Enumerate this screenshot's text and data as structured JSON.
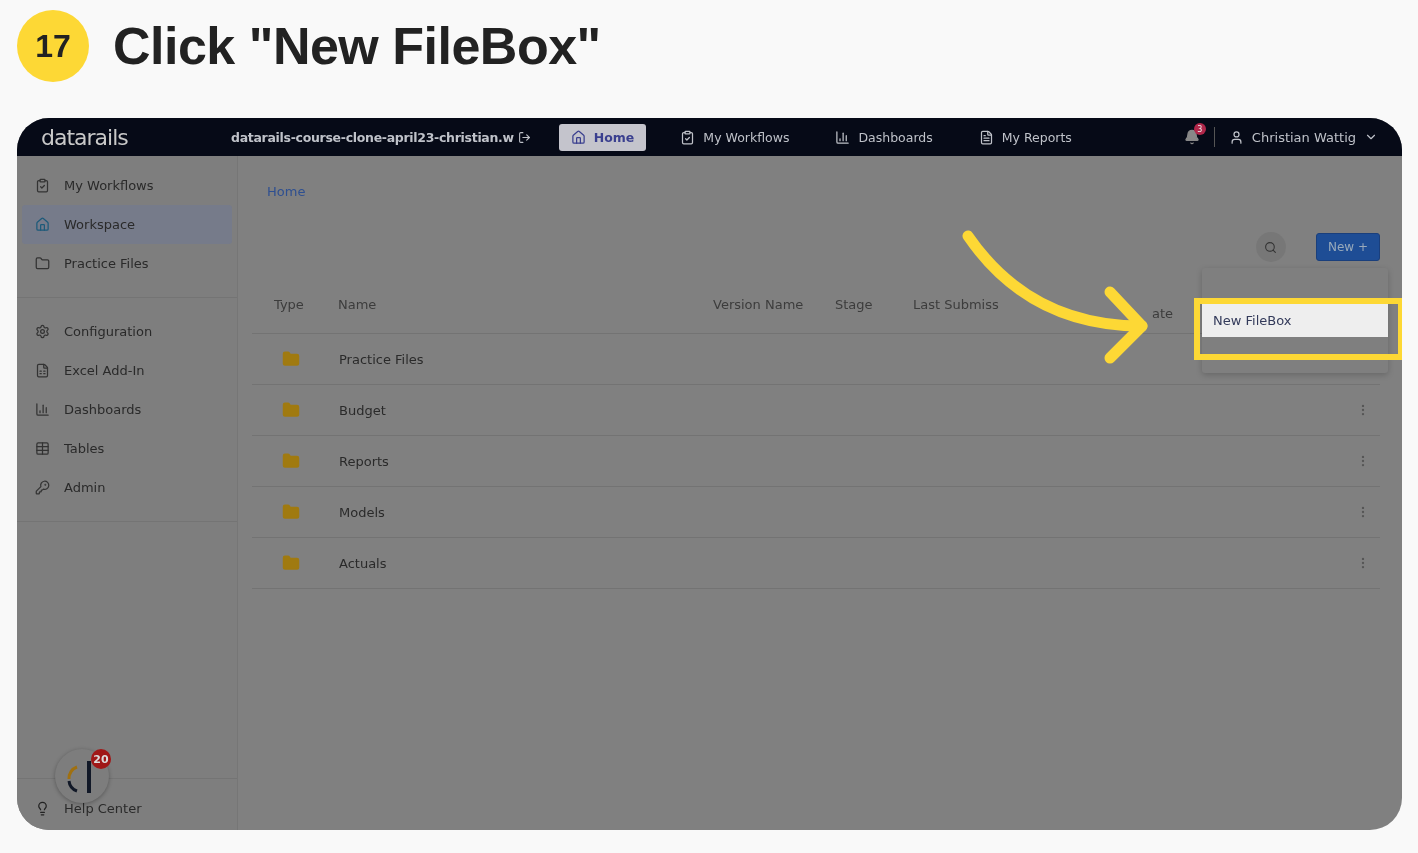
{
  "step": {
    "number": "17",
    "title": "Click \"New FileBox\""
  },
  "topbar": {
    "logo": "datarails",
    "workspace": "datarails-course-clone-april23-christian.w",
    "nav": [
      {
        "label": "Home",
        "selected": true
      },
      {
        "label": "My Workflows",
        "selected": false
      },
      {
        "label": "Dashboards",
        "selected": false
      },
      {
        "label": "My Reports",
        "selected": false
      }
    ],
    "notifications": "3",
    "user": "Christian Wattig"
  },
  "sidebar": {
    "groups": [
      [
        {
          "label": "My Workflows",
          "selected": false
        },
        {
          "label": "Workspace",
          "selected": true
        },
        {
          "label": "Practice Files",
          "selected": false
        }
      ],
      [
        {
          "label": "Configuration",
          "selected": false
        },
        {
          "label": "Excel Add-In",
          "selected": false
        },
        {
          "label": "Dashboards",
          "selected": false
        },
        {
          "label": "Tables",
          "selected": false
        },
        {
          "label": "Admin",
          "selected": false
        }
      ]
    ],
    "help_badge": "20",
    "help": "Help Center"
  },
  "breadcrumb": "Home",
  "new_button": "New +",
  "table": {
    "columns": [
      [
        "Type"
      ],
      [
        "Name"
      ],
      [
        "Version Name"
      ],
      [
        "Stage"
      ],
      [
        "Last Submiss"
      ],
      [
        "ate"
      ]
    ],
    "rows": [
      {
        "name": "Practice Files"
      },
      {
        "name": "Budget"
      },
      {
        "name": "Reports"
      },
      {
        "name": "Models"
      },
      {
        "name": "Actuals"
      }
    ]
  },
  "menu": [
    {
      "label": "New FileBox",
      "highlighted": true
    }
  ]
}
